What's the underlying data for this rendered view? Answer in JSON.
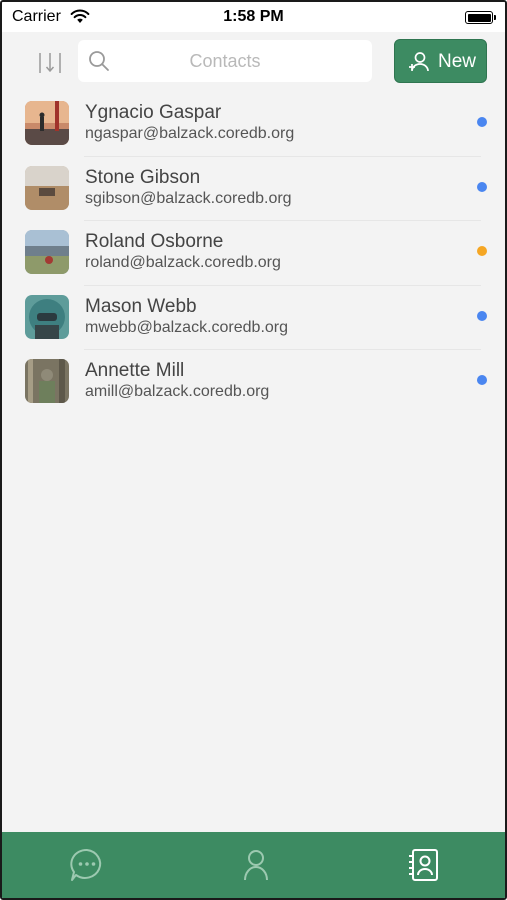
{
  "status_bar": {
    "carrier": "Carrier",
    "time": "1:58 PM",
    "battery_level": 1.0
  },
  "top_bar": {
    "sort_icon": "sort-icon",
    "search": {
      "icon": "search-icon",
      "placeholder": "Contacts",
      "value": ""
    },
    "new_button": {
      "icon": "add-user-icon",
      "label": "New"
    }
  },
  "contacts": [
    {
      "name": "Ygnacio Gaspar",
      "email": "ngaspar@balzack.coredb.org",
      "status_color": "#4a86f0"
    },
    {
      "name": "Stone Gibson",
      "email": "sgibson@balzack.coredb.org",
      "status_color": "#4a86f0"
    },
    {
      "name": "Roland Osborne",
      "email": "roland@balzack.coredb.org",
      "status_color": "#f5a623"
    },
    {
      "name": "Mason Webb",
      "email": "mwebb@balzack.coredb.org",
      "status_color": "#4a86f0"
    },
    {
      "name": "Annette Mill",
      "email": "amill@balzack.coredb.org",
      "status_color": "#4a86f0"
    }
  ],
  "tab_bar": {
    "tabs": [
      {
        "icon": "chat-icon"
      },
      {
        "icon": "profile-icon"
      },
      {
        "icon": "contacts-icon"
      }
    ],
    "active_tab": "contacts-icon"
  },
  "colors": {
    "accent": "#3d8b62",
    "background": "#f3f3f3"
  }
}
